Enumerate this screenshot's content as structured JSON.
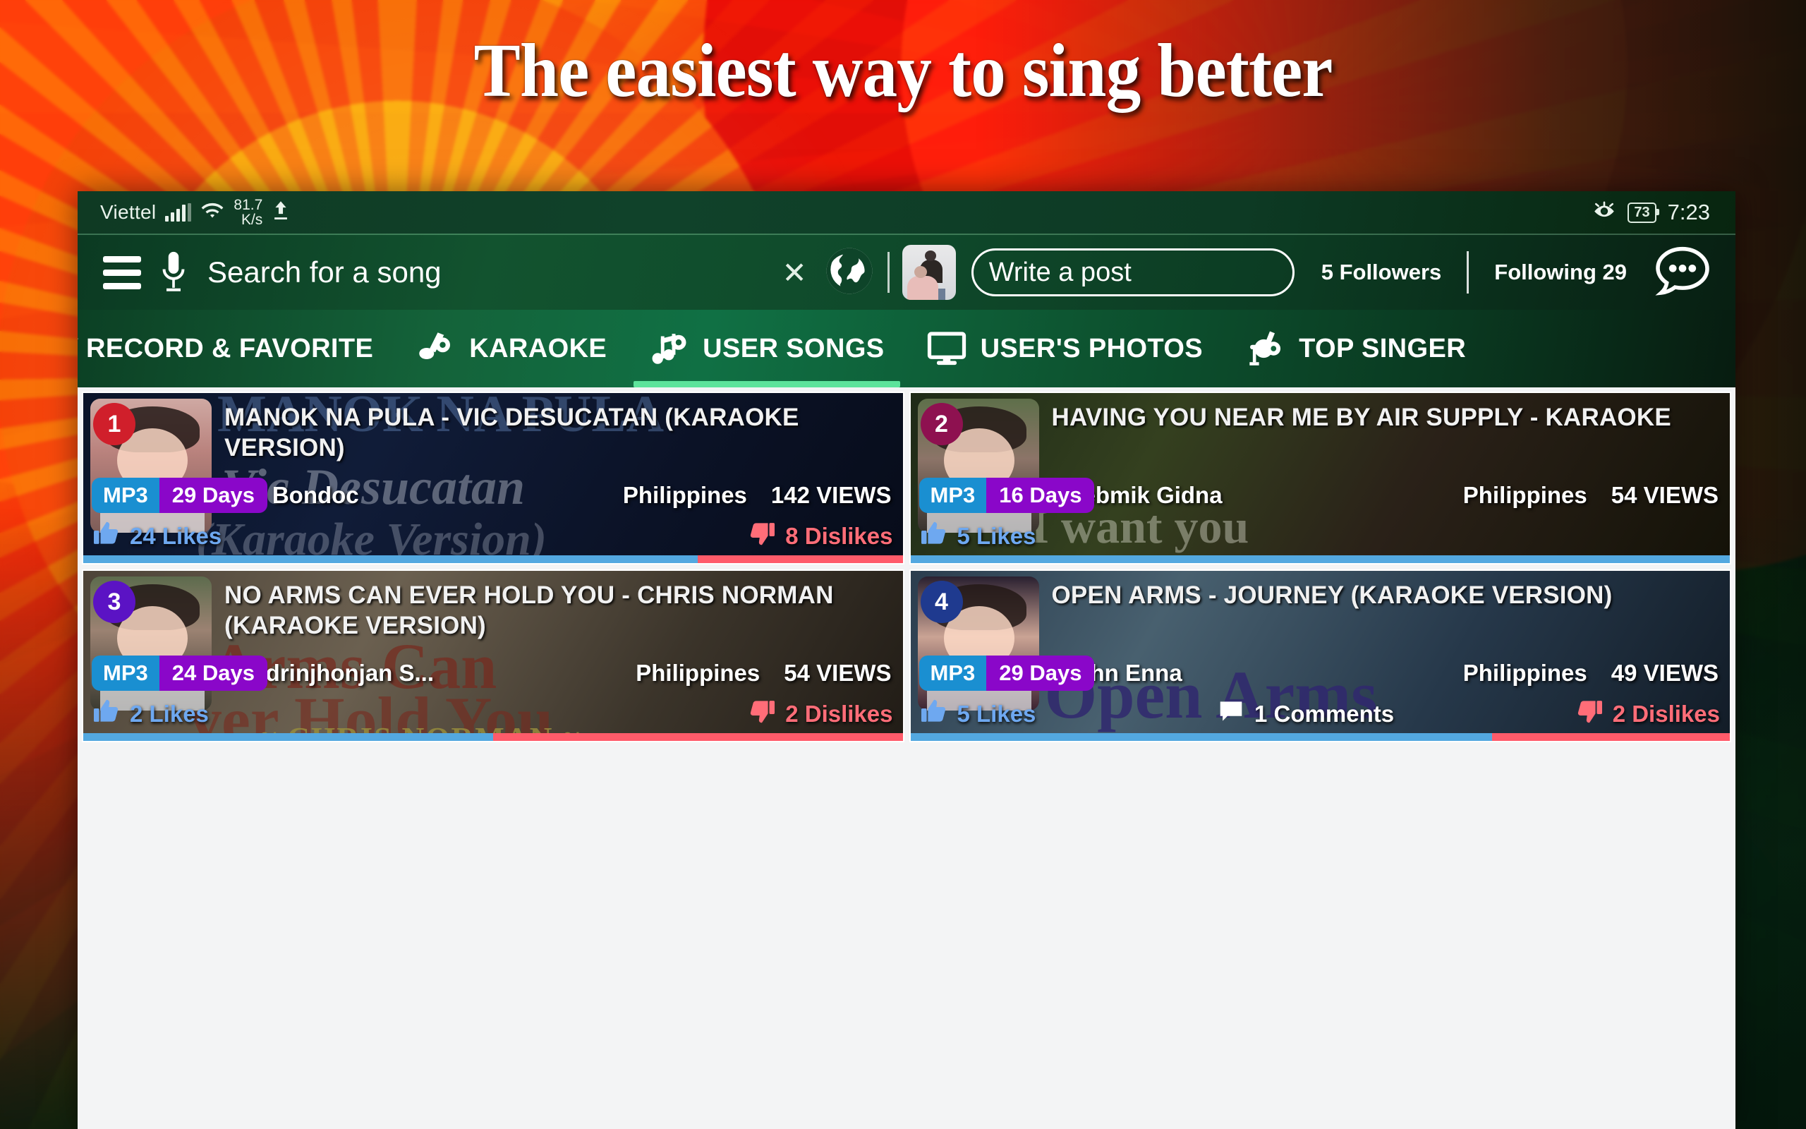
{
  "promo": {
    "headline": "The easiest way to sing better"
  },
  "status_bar": {
    "carrier": "Viettel",
    "net_speed_value": "81.7",
    "net_speed_unit": "K/s",
    "battery_level": "73",
    "clock": "7:23",
    "icons": [
      "signal-bars-icon",
      "wifi-icon",
      "upload-arrow-icon",
      "eye-care-icon",
      "battery-icon"
    ]
  },
  "header": {
    "menu_icon": "hamburger-menu-icon",
    "mic_icon": "microphone-icon",
    "search_text": "Search for a song",
    "clear_icon": "close-x-icon",
    "globe_icon": "globe-icon",
    "avatar": "user-avatar",
    "write_post_placeholder": "Write a post",
    "followers": "5 Followers",
    "following": "Following 29",
    "chat_icon": "chat-bubble-icon"
  },
  "tabs": [
    {
      "label": "Y RECORD & FAVORITE",
      "icon": "",
      "active": false,
      "clipped": true
    },
    {
      "label": "KARAOKE",
      "icon": "karaoke-note-icon",
      "active": false,
      "clipped": false
    },
    {
      "label": "USER SONGS",
      "icon": "user-songs-note-icon",
      "active": true,
      "clipped": false
    },
    {
      "label": "USER'S PHOTOS",
      "icon": "monitor-icon",
      "active": false,
      "clipped": false
    },
    {
      "label": "TOP SINGER",
      "icon": "top-singer-mic-icon",
      "active": false,
      "clipped": false
    }
  ],
  "songs": [
    {
      "rank": "1",
      "rank_color": "#d01f2b",
      "title": "MANOK NA PULA - VIC DESUCATAN (KARAOKE VERSION)",
      "format": "MP3",
      "age": "29 Days",
      "user": "Zoe Bondoc",
      "country": "Philippines",
      "views": "142 VIEWS",
      "likes": "24 Likes",
      "dislikes": "8 Dislikes",
      "comments": null,
      "like_pct": 75,
      "ghost_1": "MANOK NA PULA",
      "ghost_2": "Vic Desucatan",
      "ghost_3": "(Karaoke Version)"
    },
    {
      "rank": "2",
      "rank_color": "#8e1150",
      "title": "HAVING YOU NEAR ME BY AIR SUPPLY - KARAOKE",
      "format": "MP3",
      "age": "16 Days",
      "user": "Ylrebmik Gidna",
      "country": "Philippines",
      "views": "54 VIEWS",
      "likes": "5 Likes",
      "dislikes": null,
      "comments": null,
      "like_pct": 100,
      "ghost_1": "I want you",
      "ghost_2": "",
      "ghost_3": ""
    },
    {
      "rank": "3",
      "rank_color": "#5b13c4",
      "title": "NO ARMS CAN EVER HOLD YOU - CHRIS NORMAN (KARAOKE VERSION)",
      "format": "MP3",
      "age": "24 Days",
      "user": "Mardrinjhonjan S...",
      "country": "Philippines",
      "views": "54 VIEWS",
      "likes": "2 Likes",
      "dislikes": "2 Dislikes",
      "comments": null,
      "like_pct": 50,
      "ghost_1": "Arms Can",
      "ghost_2": "ver Hold You",
      "ghost_3": "≈ CHRIS NORMAN ≈"
    },
    {
      "rank": "4",
      "rank_color": "#1f3a8f",
      "title": "OPEN ARMS - JOURNEY (KARAOKE VERSION)",
      "format": "MP3",
      "age": "29 Days",
      "user": "Srohn Enna",
      "country": "Philippines",
      "views": "49 VIEWS",
      "likes": "5 Likes",
      "dislikes": "2 Dislikes",
      "comments": "1 Comments",
      "like_pct": 71,
      "ghost_1": "Open Arms",
      "ghost_2": "",
      "ghost_3": ""
    }
  ],
  "colors": {
    "accent_green": "#5ce39b",
    "mp3_badge": "#1a8fd1",
    "days_badge": "#8a07c9",
    "like_blue": "#53a8e0",
    "dislike_red": "#ff5b6a"
  }
}
